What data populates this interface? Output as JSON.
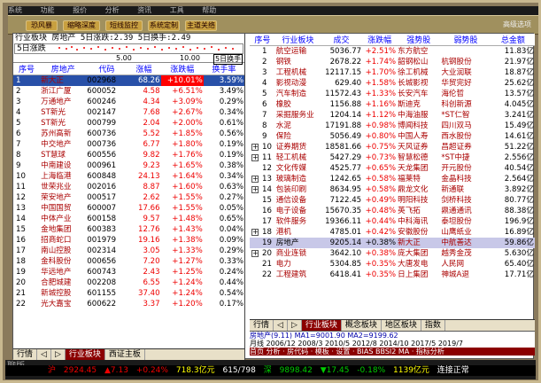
{
  "top_menu": [
    "系统",
    "功能",
    "报价",
    "分析",
    "资讯",
    "工具",
    "帮助"
  ],
  "toolbar": {
    "buttons": [
      "恐风暴",
      "缩略深度",
      "短线监控",
      "系统定制",
      "主道关络"
    ],
    "right_label": "高级选项"
  },
  "left_panel": {
    "summary": "行业板块 房地产 5日涨跌:2.39 5日换手:2.49",
    "spark_label": "5日涨跌",
    "axis": {
      "a": "5.00",
      "b": "10.00",
      "c": "5日换手"
    },
    "columns": [
      "序号",
      "房地产",
      "代码",
      "涨幅",
      "涨跌幅",
      "换手率"
    ],
    "rows": [
      [
        "1",
        "新大正",
        "002968",
        "68.26",
        "+10.01%",
        "3.59%"
      ],
      [
        "2",
        "浙江广厦",
        "600052",
        "4.58",
        "+6.51%",
        "3.49%"
      ],
      [
        "3",
        "万通地产",
        "600246",
        "4.34",
        "+3.09%",
        "0.29%"
      ],
      [
        "4",
        "ST新光",
        "002147",
        "7.68",
        "+2.67%",
        "0.34%"
      ],
      [
        "5",
        "ST新光",
        "000799",
        "2.04",
        "+2.00%",
        "0.61%"
      ],
      [
        "6",
        "苏州高新",
        "600736",
        "5.52",
        "+1.85%",
        "0.56%"
      ],
      [
        "7",
        "中交地产",
        "000736",
        "6.77",
        "+1.80%",
        "0.19%"
      ],
      [
        "8",
        "ST慧球",
        "600556",
        "9.82",
        "+1.76%",
        "0.19%"
      ],
      [
        "9",
        "中南建设",
        "000961",
        "9.23",
        "+1.65%",
        "0.38%"
      ],
      [
        "10",
        "上海临港",
        "600848",
        "24.13",
        "+1.64%",
        "0.34%"
      ],
      [
        "11",
        "世荣兆业",
        "002016",
        "8.87",
        "+1.60%",
        "0.63%"
      ],
      [
        "12",
        "荣安地产",
        "000517",
        "2.62",
        "+1.55%",
        "0.27%"
      ],
      [
        "13",
        "中国国贸",
        "600007",
        "17.66",
        "+1.55%",
        "0.05%"
      ],
      [
        "14",
        "中体产业",
        "600158",
        "9.57",
        "+1.48%",
        "0.65%"
      ],
      [
        "15",
        "金地集团",
        "600383",
        "12.76",
        "+1.43%",
        "0.04%"
      ],
      [
        "16",
        "招商蛇口",
        "001979",
        "19.16",
        "+1.38%",
        "0.09%"
      ],
      [
        "17",
        "南山控股",
        "002314",
        "3.05",
        "+1.33%",
        "0.29%"
      ],
      [
        "18",
        "金科股份",
        "000656",
        "7.20",
        "+1.27%",
        "0.33%"
      ],
      [
        "19",
        "华远地产",
        "600743",
        "2.43",
        "+1.25%",
        "0.24%"
      ],
      [
        "20",
        "合肥城建",
        "002208",
        "6.55",
        "+1.24%",
        "0.44%"
      ],
      [
        "21",
        "新城控股",
        "601155",
        "37.40",
        "+1.24%",
        "0.54%"
      ],
      [
        "22",
        "光大嘉宝",
        "600622",
        "3.37",
        "+1.20%",
        "0.17%"
      ]
    ],
    "tabs": [
      "行情",
      "◁",
      "▷",
      "行业板块",
      "西证主板"
    ]
  },
  "right_panel": {
    "columns": [
      "序号",
      "行业板块",
      "成交",
      "涨跌幅",
      "强势股",
      "弱势股",
      "总金额"
    ],
    "rows": [
      [
        "1",
        "航空运输",
        "5036.77",
        "+2.51%",
        "东方航空",
        "",
        "11.83亿"
      ],
      [
        "2",
        "钢铁",
        "2678.22",
        "+1.74%",
        "韶钢松山",
        "杭钢股份",
        "21.97亿"
      ],
      [
        "3",
        "工程机械",
        "12117.15",
        "+1.70%",
        "徐工机械",
        "大业润联",
        "18.87亿"
      ],
      [
        "4",
        "影视动漫",
        "629.40",
        "+1.58%",
        "长城影视",
        "华贸完好",
        "25.62亿"
      ],
      [
        "5",
        "汽车制造",
        "11572.43",
        "+1.33%",
        "长安汽车",
        "海伦哲",
        "13.57亿"
      ],
      [
        "6",
        "橡胶",
        "1156.88",
        "+1.16%",
        "斯迪克",
        "科创新源",
        "4.045亿"
      ],
      [
        "7",
        "采掘服务业",
        "1204.14",
        "+1.12%",
        "中海油服",
        "*ST仁智",
        "3.241亿"
      ],
      [
        "8",
        "水泥",
        "17191.88",
        "+0.98%",
        "博闻科技",
        "四川双马",
        "15.49亿"
      ],
      [
        "9",
        "保险",
        "5056.49",
        "+0.80%",
        "中国人寿",
        "西水股份",
        "14.61亿"
      ],
      [
        "10",
        "证券期货",
        "18581.66",
        "+0.75%",
        "天风证券",
        "昌超证券",
        "51.22亿"
      ],
      [
        "11",
        "轻工机械",
        "5427.29",
        "+0.73%",
        "智慧松德",
        "*ST中捷",
        "2.556亿"
      ],
      [
        "12",
        "文化传媒",
        "4525.77",
        "+0.65%",
        "天龙集团",
        "开元股份",
        "40.54亿"
      ],
      [
        "13",
        "玻璃制造",
        "1242.65",
        "+0.58%",
        "福莱特",
        "金晶科技",
        "2.564亿"
      ],
      [
        "14",
        "包装印刷",
        "8634.95",
        "+0.58%",
        "鼎龙文化",
        "新通联",
        "3.892亿"
      ],
      [
        "15",
        "通信设备",
        "7122.45",
        "+0.49%",
        "明阳科技",
        "剑桥科技",
        "80.77亿"
      ],
      [
        "16",
        "电子设备",
        "15670.35",
        "+0.48%",
        "英飞拓",
        "鼎通通讯",
        "88.38亿"
      ],
      [
        "17",
        "软件服务",
        "19366.11",
        "+0.44%",
        "中科海讯",
        "泰坦股份",
        "196.9亿"
      ],
      [
        "18",
        "港机",
        "4785.01",
        "+0.42%",
        "安徽股份",
        "山鹰纸业",
        "16.89亿"
      ],
      [
        "19",
        "房地产",
        "9205.14",
        "+0.38%",
        "新大正",
        "中航善达",
        "59.86亿"
      ],
      [
        "20",
        "商业连锁",
        "3642.10",
        "+0.38%",
        "庞大集团",
        "越秀金茂",
        "5.630亿"
      ],
      [
        "21",
        "电力",
        "5304.85",
        "+0.35%",
        "大唐发电",
        "人民网",
        "65.40亿"
      ],
      [
        "22",
        "工程建筑",
        "6418.41",
        "+0.35%",
        "日上集团",
        "神城A退",
        "17.71亿"
      ]
    ],
    "tabs": [
      "行情",
      "◁",
      "▷",
      "行业板块",
      "概念板块",
      "地区板块",
      "指数"
    ]
  },
  "info": {
    "line1": "房地产(9.11) MA1=9001.90 MA2=9199.62",
    "line2": "月线 2006/12 2008/3 2010/5 2012/8 2014/10 2017/5 2019/7",
    "line3": "首页 分析 · 房代码 · 模板 · 设置 · BIAS BBSI2 MA · 指标分析"
  },
  "status": {
    "label": "聊版",
    "items": [
      "沪",
      "2924.45",
      "▲7.13",
      "+0.24%",
      "718.3亿元",
      "615/798",
      "深",
      "9898.42",
      "▼17.45",
      "-0.18%",
      "1139亿元",
      "连接正常"
    ]
  },
  "colors": {
    "accent": "#8b0000",
    "up": "#e00000",
    "select": "#2850a8"
  }
}
